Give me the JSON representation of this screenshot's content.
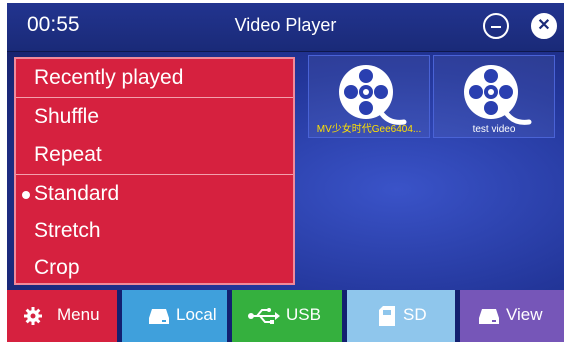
{
  "status": {
    "time": "00:55"
  },
  "window": {
    "title": "Video Player"
  },
  "videos": [
    {
      "label": "MV少女时代Gee6404..."
    },
    {
      "label": "test video"
    }
  ],
  "menu": {
    "items": [
      {
        "label": "Recently played"
      },
      {
        "label": "Shuffle"
      },
      {
        "label": "Repeat"
      },
      {
        "label": "Standard",
        "selected": true
      },
      {
        "label": "Stretch"
      },
      {
        "label": "Crop"
      }
    ]
  },
  "bottombar": {
    "menu": "Menu",
    "local": "Local",
    "usb": "USB",
    "sd": "SD",
    "view": "View"
  },
  "colors": {
    "menu_bg": "#d6213f",
    "local": "#3fa0dc",
    "usb": "#35b03e",
    "sd": "#8fc6ec",
    "view": "#7656b8",
    "highlight_label": "#ffe000"
  },
  "icons": {
    "minimize": "minimize-icon",
    "close": "close-icon",
    "video": "film-reel-icon",
    "menu": "gear-icon",
    "local": "hard-drive-icon",
    "usb": "usb-icon",
    "sd": "sd-card-icon",
    "view": "hard-drive-icon"
  }
}
